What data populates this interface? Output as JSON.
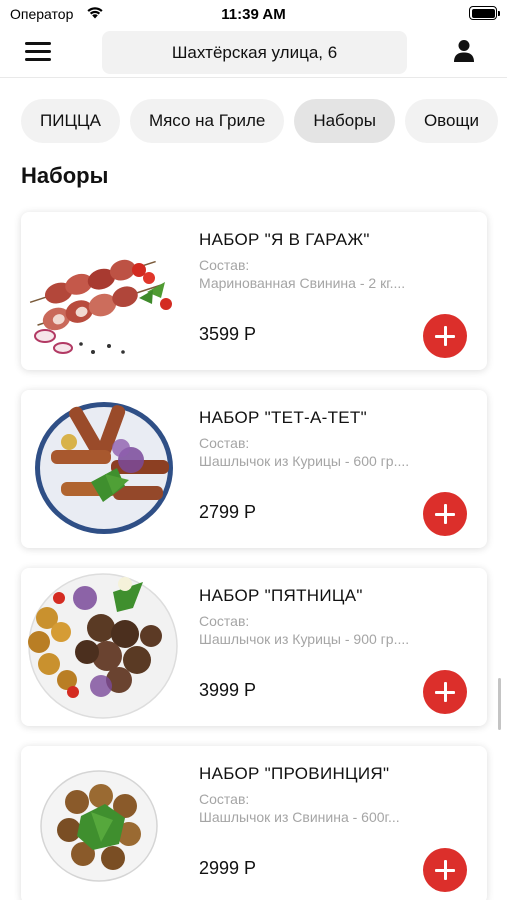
{
  "status_bar": {
    "carrier": "Оператор",
    "time": "11:39 AM"
  },
  "header": {
    "address": "Шахтёрская улица, 6"
  },
  "categories": [
    {
      "label": "ПИЦЦА",
      "active": false
    },
    {
      "label": "Мясо на Гриле",
      "active": false
    },
    {
      "label": "Наборы",
      "active": true
    },
    {
      "label": "Овощи",
      "active": false
    }
  ],
  "section": {
    "title": "Наборы"
  },
  "products": [
    {
      "name": "НАБОР \"Я В ГАРАЖ\"",
      "composition_label": "Состав:",
      "composition": "Маринованная Свинина - 2 кг....",
      "price": "3599 Р"
    },
    {
      "name": "НАБОР \"ТЕТ-А-ТЕТ\"",
      "composition_label": "Состав:",
      "composition": "Шашлычок из Курицы - 600 гр....",
      "price": "2799 Р"
    },
    {
      "name": "НАБОР \"ПЯТНИЦА\"",
      "composition_label": "Состав:",
      "composition": "Шашлычок из Курицы - 900 гр....",
      "price": "3999 Р"
    },
    {
      "name": "НАБОР \"ПРОВИНЦИЯ\"",
      "composition_label": "Состав:",
      "composition": "Шашлычок из Свинина - 600г...",
      "price": "2999 Р"
    }
  ],
  "colors": {
    "accent": "#dc2f2b",
    "chip_bg": "#f2f2f2",
    "chip_active_bg": "#e4e4e4",
    "muted_text": "#a5a5a5"
  },
  "icons": [
    "wifi-icon",
    "battery-icon",
    "menu-icon",
    "profile-icon",
    "plus-icon"
  ]
}
